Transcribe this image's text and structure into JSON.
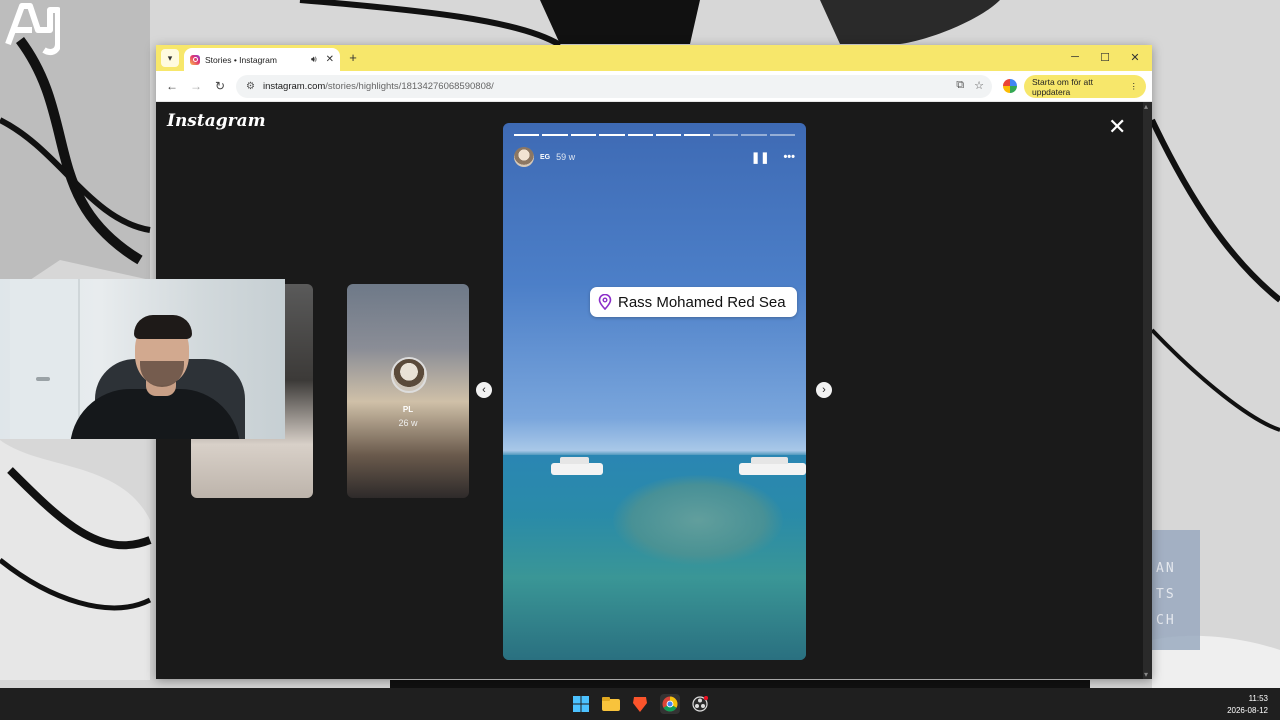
{
  "browser": {
    "tab_title": "Stories • Instagram",
    "new_tab_symbol": "+",
    "url_domain": "instagram.com",
    "url_path": "/stories/highlights/18134276068590808/",
    "update_button_label": "Starta om för att uppdatera",
    "icons": [
      "back-arrow-icon",
      "forward-arrow-icon",
      "reload-icon",
      "site-settings-icon",
      "install-app-icon",
      "bookmark-star-icon",
      "profile-icon",
      "more-menu-icon",
      "speaker-icon",
      "close-icon",
      "minimize-icon",
      "maximize-icon"
    ]
  },
  "instagram": {
    "logo_text": "Instagram",
    "close_symbol": "✕",
    "prev_arrow": "‹",
    "next_arrow": "›",
    "side_preview": {
      "username": "PL",
      "time": "26 w"
    },
    "story": {
      "username": "EG",
      "time": "59 w",
      "progress_total": 10,
      "progress_done": 7,
      "pause_symbol": "❚❚",
      "more_symbol": "•••",
      "location": "Rass Mohamed Red Sea"
    }
  },
  "overlay": {
    "side_panel_lines": [
      "AN",
      "TS",
      "CH"
    ]
  },
  "taskbar": {
    "time": "11:53",
    "date": "2026-08-12",
    "apps": [
      "windows-start-icon",
      "file-explorer-icon",
      "brave-browser-icon",
      "chrome-browser-icon",
      "obs-studio-icon"
    ]
  },
  "colors": {
    "browser_frame": "#f7e76b",
    "page_background": "#1a1a1a",
    "taskbar": "#1f1f1f",
    "location_pin": "#8b2fc9"
  }
}
